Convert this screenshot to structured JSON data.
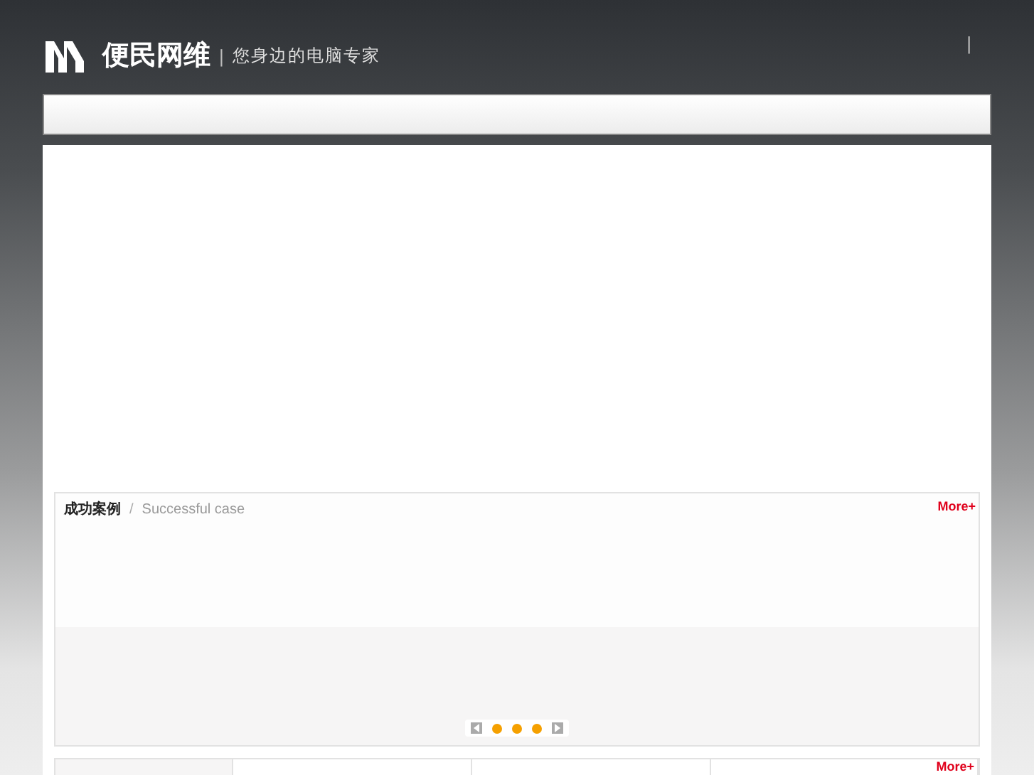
{
  "header": {
    "brand": "便民网维",
    "slogan": "您身边的电脑专家",
    "divider": "|"
  },
  "cases": {
    "title": "成功案例",
    "separator": "/",
    "subtitle": "Successful case",
    "more": "More+"
  },
  "news": {
    "more": "More+"
  }
}
